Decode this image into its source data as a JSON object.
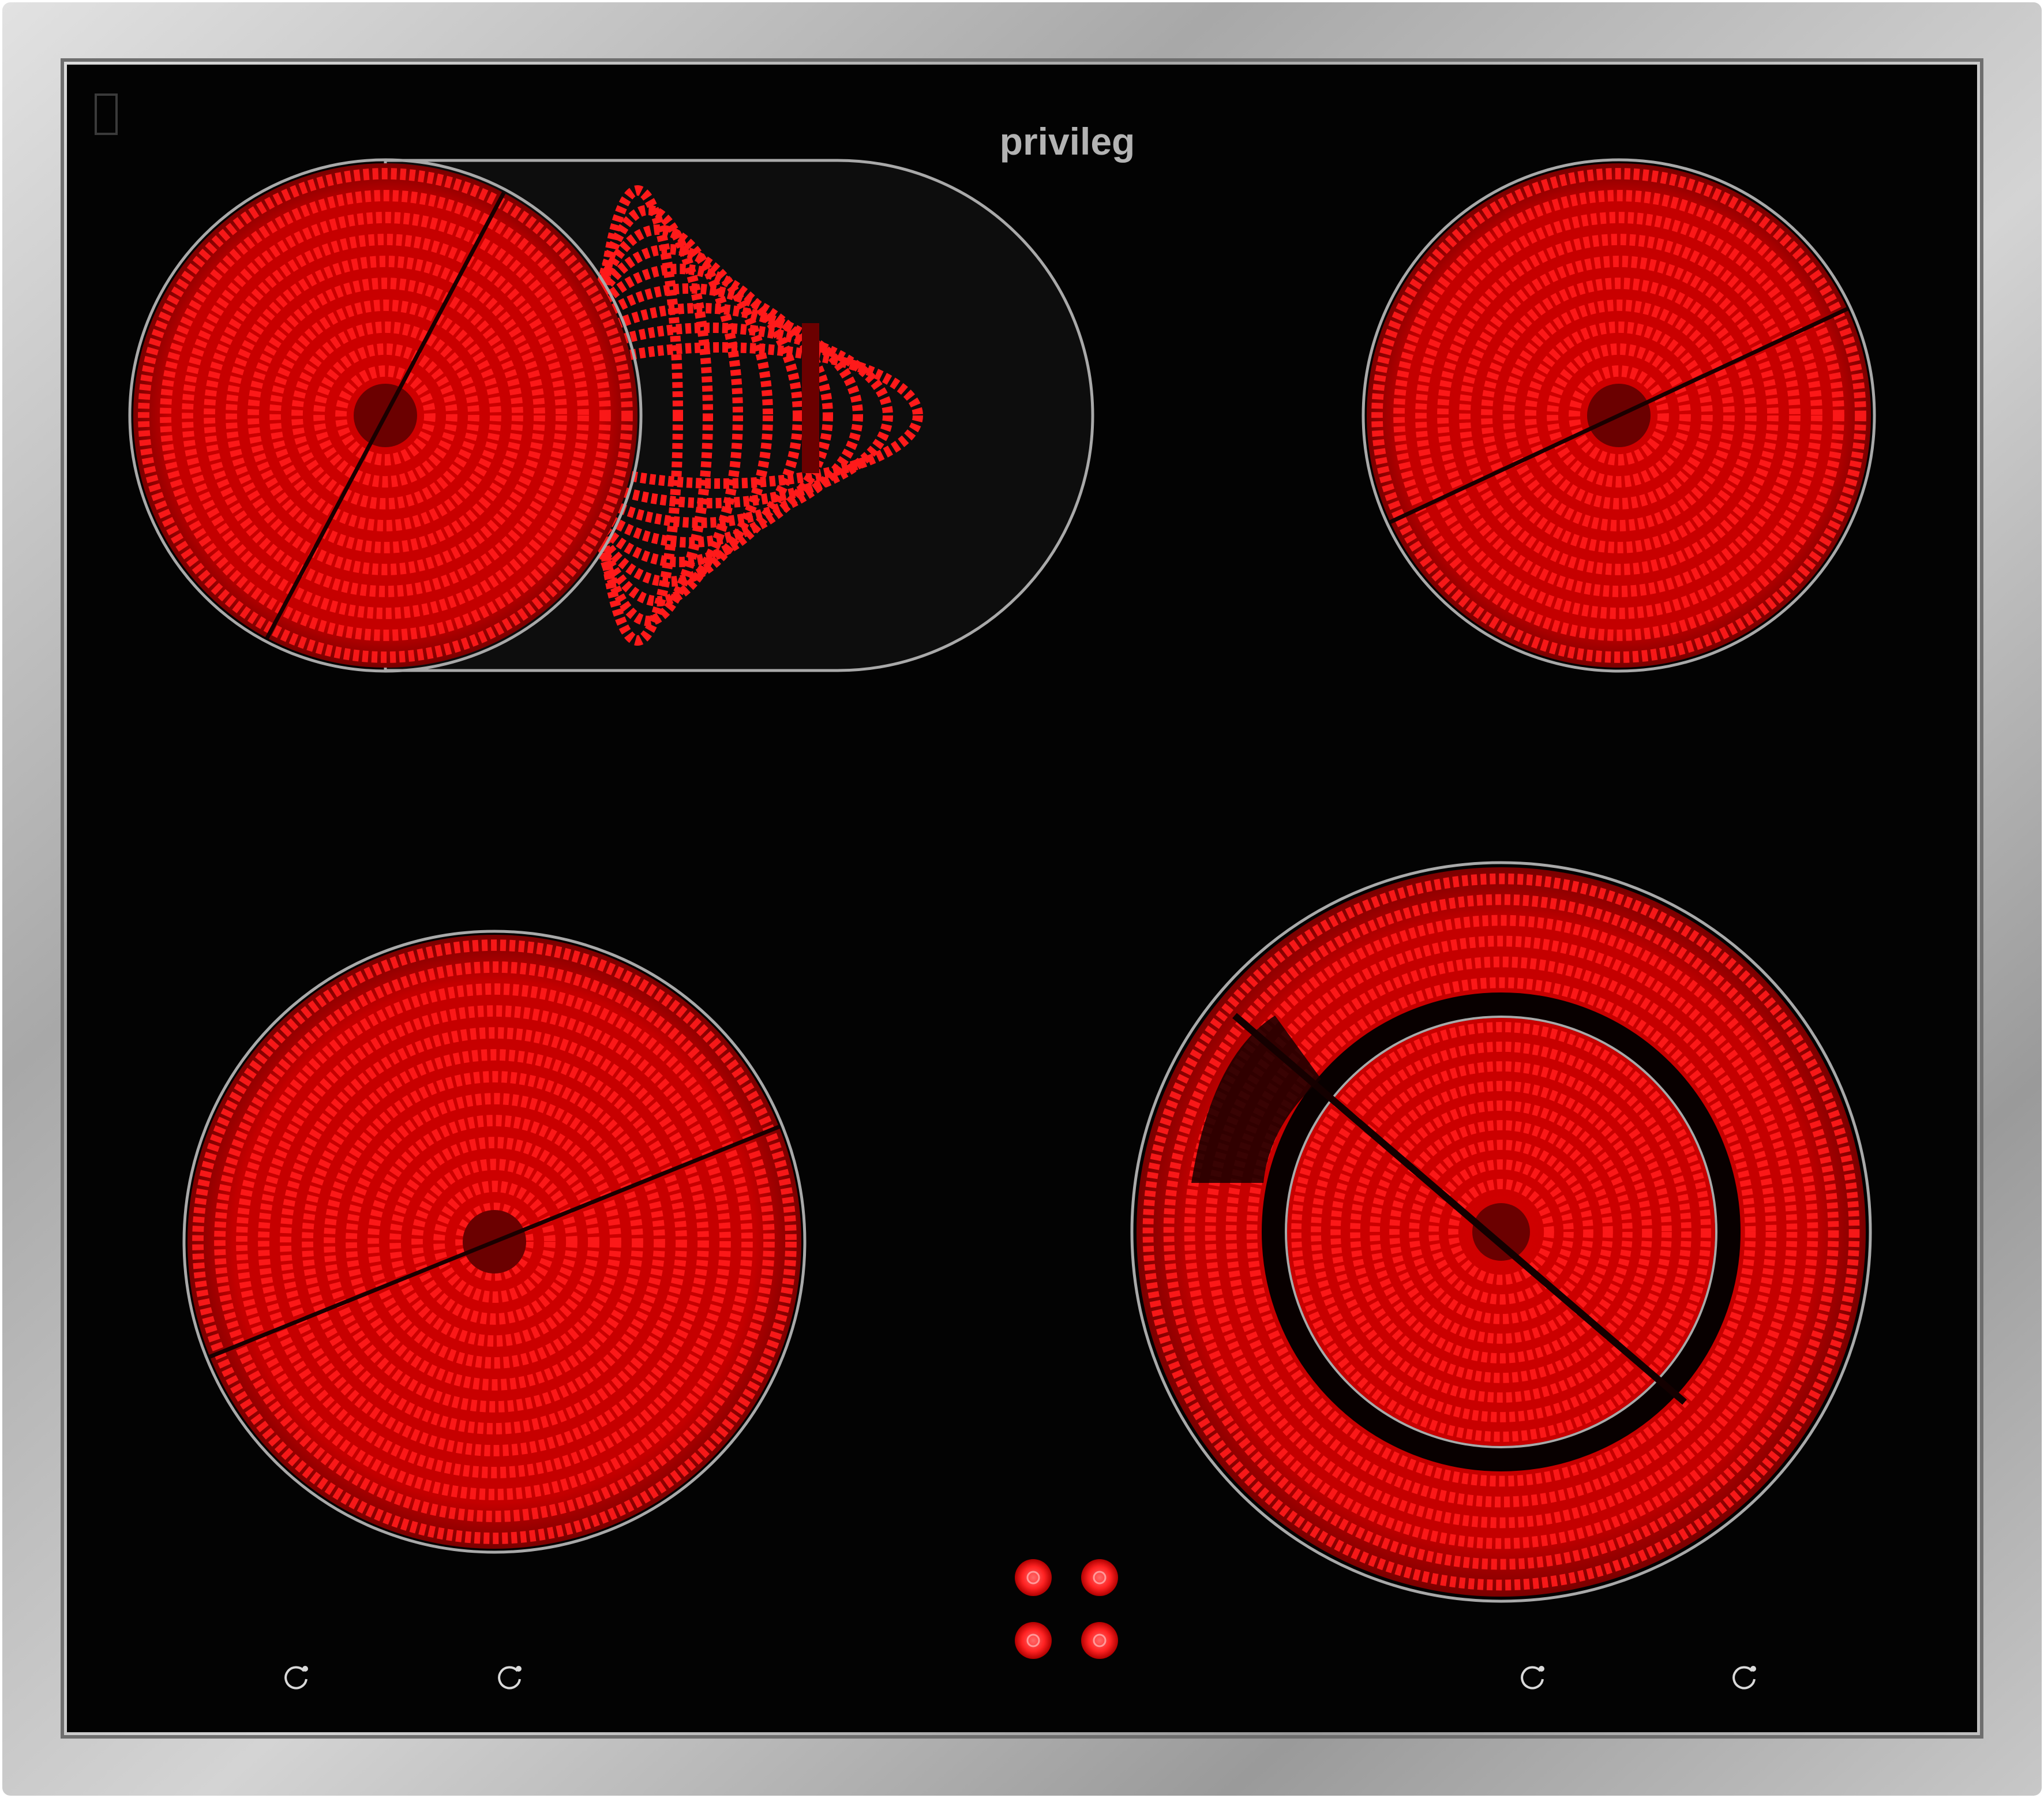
{
  "brand": {
    "name": "privileg"
  },
  "colors": {
    "frame": "#b9b9b9",
    "frame_light": "#dadada",
    "frame_dark": "#8f8f8f",
    "glass": "#030303",
    "zone_rim": "#a9a9a9",
    "coil": "#ff1a1a",
    "coil_dark": "#6b0000",
    "zone_base": "#c00000",
    "indicator": "#ff2a2a",
    "symbol": "#d9d9d9",
    "logo_text": "#b3b3b3"
  },
  "cooking_zones": [
    {
      "id": "front-left"
    },
    {
      "id": "rear-left-extended"
    },
    {
      "id": "rear-right"
    },
    {
      "id": "front-right-dual"
    }
  ],
  "control_symbols": [
    {
      "icon": "zone-symbol-icon"
    },
    {
      "icon": "zone-symbol-icon"
    },
    {
      "icon": "zone-symbol-icon"
    },
    {
      "icon": "zone-symbol-icon"
    }
  ],
  "hot_indicators": [
    {
      "icon": "residual-heat-lamp-icon"
    },
    {
      "icon": "residual-heat-lamp-icon"
    },
    {
      "icon": "residual-heat-lamp-icon"
    },
    {
      "icon": "residual-heat-lamp-icon"
    }
  ]
}
